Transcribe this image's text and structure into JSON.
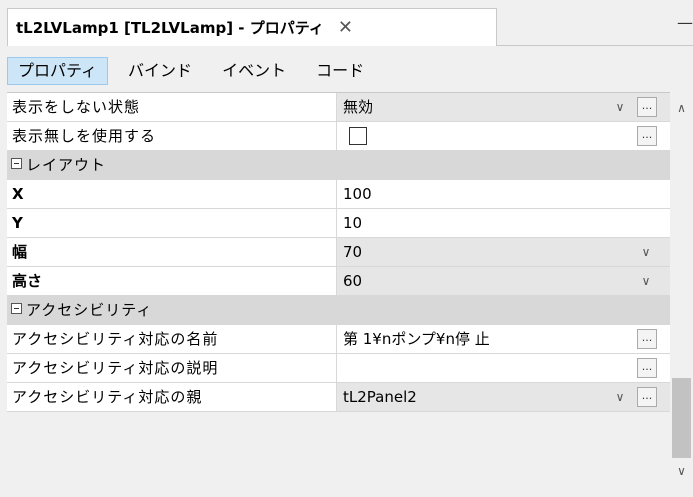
{
  "window": {
    "title": "tL2LVLamp1 [TL2LVLamp] - プロパティ",
    "close_glyph": "✕",
    "pin_glyph": "—"
  },
  "subtabs": [
    {
      "label": "プロパティ",
      "active": true
    },
    {
      "label": "バインド",
      "active": false
    },
    {
      "label": "イベント",
      "active": false
    },
    {
      "label": "コード",
      "active": false
    }
  ],
  "properties": {
    "row_disabled_state": {
      "name": "表示をしない状態",
      "value": "無効"
    },
    "row_use_hidden": {
      "name": "表示無しを使用する",
      "value": ""
    },
    "cat_layout": {
      "label": "レイアウト"
    },
    "row_x": {
      "name": "X",
      "value": "100"
    },
    "row_y": {
      "name": "Y",
      "value": "10"
    },
    "row_width": {
      "name": "幅",
      "value": "70"
    },
    "row_height": {
      "name": "高さ",
      "value": "60"
    },
    "cat_accessibility": {
      "label": "アクセシビリティ"
    },
    "row_acc_name": {
      "name": "アクセシビリティ対応の名前",
      "value": "第 1¥nポンプ¥n停 止"
    },
    "row_acc_desc": {
      "name": "アクセシビリティ対応の説明",
      "value": ""
    },
    "row_acc_parent": {
      "name": "アクセシビリティ対応の親",
      "value": "tL2Panel2"
    }
  },
  "glyphs": {
    "ellipsis": "...",
    "dropdown": "∨",
    "scroll_up": "∧",
    "scroll_down": "∨"
  },
  "colors": {
    "active_tab_bg": "#cde6f7",
    "category_bg": "#d8d8d8",
    "readonly_bg": "#e6e6e6"
  }
}
